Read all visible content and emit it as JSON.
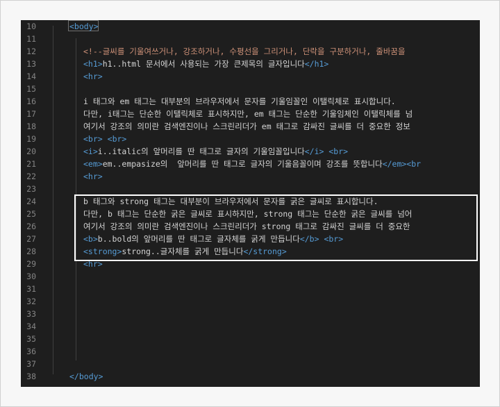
{
  "editor": {
    "lines": [
      {
        "num": "10",
        "parts": [
          {
            "t": "<body>",
            "c": "tag"
          }
        ]
      },
      {
        "num": "11",
        "parts": []
      },
      {
        "num": "12",
        "parts": [
          {
            "t": "<!--글씨를 기울여쓰거나, 강조하거나, 수평선을 그리거나, 단락을 구분하거나, 줄바꿈을",
            "c": "cmt"
          }
        ]
      },
      {
        "num": "13",
        "parts": [
          {
            "t": "<h1>",
            "c": "tag"
          },
          {
            "t": "h1..html 문서에서 사용되는 가장 큰제목의 글자입니다",
            "c": "txt"
          },
          {
            "t": "</h1>",
            "c": "tag"
          }
        ]
      },
      {
        "num": "14",
        "parts": [
          {
            "t": "<hr>",
            "c": "tag"
          }
        ]
      },
      {
        "num": "15",
        "parts": []
      },
      {
        "num": "16",
        "parts": [
          {
            "t": "i 태그와 em 태그는 대부분의 브라우저에서 문자를 기울임꼴인 이탤릭체로 표시합니다.",
            "c": "txt"
          }
        ]
      },
      {
        "num": "17",
        "parts": [
          {
            "t": "다만, i태그는 단순한 이탤릭체로 표시하지만, em 태그는 단순한 기울임체인 이탤릭체를 넘",
            "c": "txt"
          }
        ]
      },
      {
        "num": "18",
        "parts": [
          {
            "t": "여기서 강조의 의미란 검색엔진이나 스크린리더가 em 태그로 감싸진 글씨를 더 중요한 정보",
            "c": "txt"
          }
        ]
      },
      {
        "num": "19",
        "parts": [
          {
            "t": "<br>",
            "c": "tag"
          },
          {
            "t": " ",
            "c": "txt"
          },
          {
            "t": "<br>",
            "c": "tag"
          }
        ]
      },
      {
        "num": "20",
        "parts": [
          {
            "t": "<i>",
            "c": "tag"
          },
          {
            "t": "i..italic의 앞머리를 딴 태그로 글자의 기울임꼴입니다",
            "c": "txt"
          },
          {
            "t": "</i>",
            "c": "tag"
          },
          {
            "t": " ",
            "c": "txt"
          },
          {
            "t": "<br>",
            "c": "tag"
          }
        ]
      },
      {
        "num": "21",
        "parts": [
          {
            "t": "<em>",
            "c": "tag"
          },
          {
            "t": "em..empasize의  앞머리를 딴 태그로 글자의 기울음꼴이며 강조를 뜻합니다",
            "c": "txt"
          },
          {
            "t": "</em><br",
            "c": "tag"
          }
        ]
      },
      {
        "num": "22",
        "parts": [
          {
            "t": "<hr>",
            "c": "tag"
          }
        ]
      },
      {
        "num": "23",
        "parts": []
      },
      {
        "num": "24",
        "parts": [
          {
            "t": "b 태그와 strong 태그는 대부분이 브라우저에서 문자를 굵은 글씨로 표시합니다.",
            "c": "txt"
          }
        ]
      },
      {
        "num": "25",
        "parts": [
          {
            "t": "다만, b 태그는 단순한 굵은 글씨로 표시하지만, strong 태그는 단순한 굵은 글씨를 넘어",
            "c": "txt"
          }
        ]
      },
      {
        "num": "26",
        "parts": [
          {
            "t": "여기서 강조의 의미란 검색엔진이나 스크린리더가 strong 태그로 감싸진 글씨를 더 중요한",
            "c": "txt"
          }
        ]
      },
      {
        "num": "27",
        "parts": [
          {
            "t": "<b>",
            "c": "tag"
          },
          {
            "t": "b..bold의 앞머리를 딴 태그로 글자체를 굵게 만듭니다",
            "c": "txt"
          },
          {
            "t": "</b>",
            "c": "tag"
          },
          {
            "t": " ",
            "c": "txt"
          },
          {
            "t": "<br>",
            "c": "tag"
          }
        ]
      },
      {
        "num": "28",
        "parts": [
          {
            "t": "<strong>",
            "c": "tag"
          },
          {
            "t": "strong..글자체를 굵게 만듭니다",
            "c": "txt"
          },
          {
            "t": "</strong>",
            "c": "tag"
          }
        ]
      },
      {
        "num": "29",
        "parts": [
          {
            "t": "<hr>",
            "c": "tag"
          }
        ]
      },
      {
        "num": "30",
        "parts": []
      },
      {
        "num": "31",
        "parts": []
      },
      {
        "num": "32",
        "parts": []
      },
      {
        "num": "33",
        "parts": []
      },
      {
        "num": "34",
        "parts": []
      },
      {
        "num": "35",
        "parts": []
      },
      {
        "num": "36",
        "parts": []
      },
      {
        "num": "37",
        "parts": []
      },
      {
        "num": "38",
        "parts": [
          {
            "t": "</body>",
            "c": "tag"
          }
        ]
      }
    ]
  },
  "colors": {
    "background": "#1e1e1e",
    "tag": "#569cd6",
    "comment": "#ce9178",
    "text": "#d4d4d4",
    "line_number": "#858585",
    "selection_border": "#ffffff"
  }
}
